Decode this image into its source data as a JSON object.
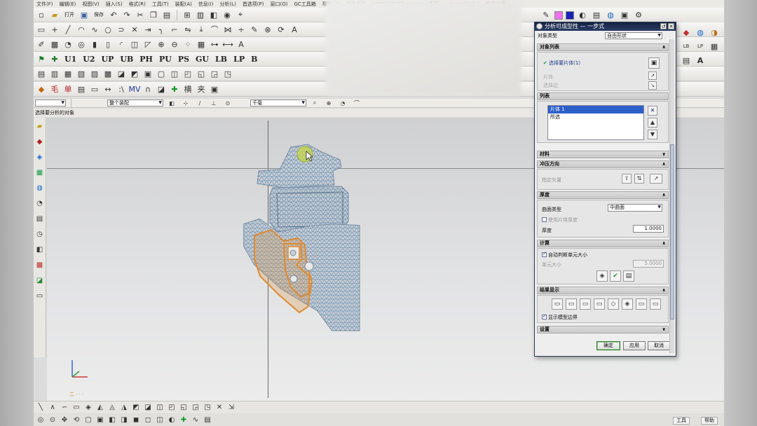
{
  "menubar": [
    "文件(F)",
    "编辑(E)",
    "视图(V)",
    "插入(S)",
    "格式(R)",
    "工具(T)",
    "装配(A)",
    "信息(I)",
    "分析(L)",
    "首选项(P)",
    "窗口(O)",
    "GC工具箱",
    "帮助(H)",
    "程序启动",
    "595210317@qq.com（贞斌）",
    "PressIC V8.1",
    "实用工具"
  ],
  "toolbar3_labels": [
    "U1",
    "U2",
    "UP",
    "UB",
    "PH",
    "PU",
    "PS",
    "GU",
    "LB",
    "LP",
    "B"
  ],
  "toolbar_open_label": "打开",
  "toolbar_save_label": "保存",
  "selection_bar": {
    "filter": "",
    "scope": "整个装配",
    "mode": "千毫"
  },
  "status_text": "选择要分析的对象",
  "viewport": {
    "warning": "  二  ·  ·  ·"
  },
  "dialog": {
    "title": "分析可成型性 — 一步式",
    "type_label": "对象类型",
    "type_value": "自由形状",
    "section_object": "对象列表",
    "selected_text": "选择要片体(1)",
    "row_hidden1": "片体",
    "row_hidden2": "选择边",
    "list_section": "列表",
    "list_items": [
      "片体 1",
      "所选"
    ],
    "section_material": "材料",
    "section_punch": "冲压方向",
    "punch_label": "指定矢量",
    "section_thickness": "厚度",
    "surface_type_label": "曲面类型",
    "surface_type_value": "中曲面",
    "use_thickness_label": "使用片体厚度",
    "thickness_label": "厚度",
    "thickness_value": "1.0000",
    "section_mesh": "计算",
    "auto_mesh_label": "自动判断单元大小",
    "element_size_label": "单元大小",
    "element_size_value": "5.0000",
    "section_result": "结果显示",
    "show_boundary_label": "显示模型边界",
    "section_settings": "设置",
    "ok": "确定",
    "apply": "应用",
    "cancel": "取消"
  },
  "bottom": {
    "work_label": "工具",
    "help_label": "帮助"
  },
  "colors": {
    "title_bar": "#1b2a4d",
    "part_orange": "#e08a30",
    "part_mesh": "#5f86a6",
    "highlight": "#c8d840"
  }
}
